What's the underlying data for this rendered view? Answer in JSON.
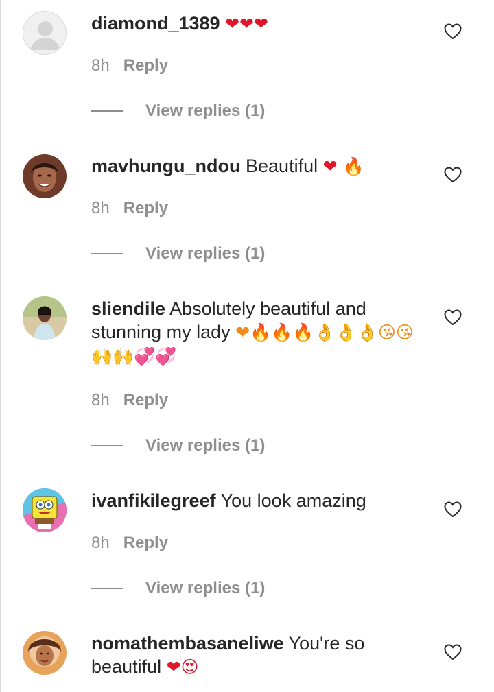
{
  "comments": [
    {
      "username": "diamond_1389",
      "text": "",
      "emojis": "❤❤❤",
      "time": "8h",
      "reply_label": "Reply",
      "view_replies_label": "View replies (1)",
      "avatar": "default-avatar"
    },
    {
      "username": "mavhungu_ndou",
      "text": "Beautiful",
      "emojis": "❤ 🔥",
      "time": "8h",
      "reply_label": "Reply",
      "view_replies_label": "View replies (1)",
      "avatar": "photo-avatar"
    },
    {
      "username": "sliendile",
      "text": "Absolutely beautiful and stunning my lady",
      "emojis": "❤🔥🔥🔥👌👌👌😘😘🙌🙌💞💞",
      "time": "8h",
      "reply_label": "Reply",
      "view_replies_label": "View replies (1)",
      "avatar": "photo-avatar"
    },
    {
      "username": "ivanfikilegreef",
      "text": "You look amazing",
      "emojis": "",
      "time": "8h",
      "reply_label": "Reply",
      "view_replies_label": "View replies (1)",
      "avatar": "cartoon-avatar"
    },
    {
      "username": "nomathembasaneliwe",
      "text": "You're so beautiful",
      "emojis": "❤😍",
      "time": "",
      "reply_label": "",
      "view_replies_label": "",
      "avatar": "photo-avatar"
    }
  ],
  "icons": {
    "like": "heart-outline-icon"
  },
  "colors": {
    "username": "#262626",
    "meta": "#8e8e8e",
    "heart": "#e0162b"
  }
}
